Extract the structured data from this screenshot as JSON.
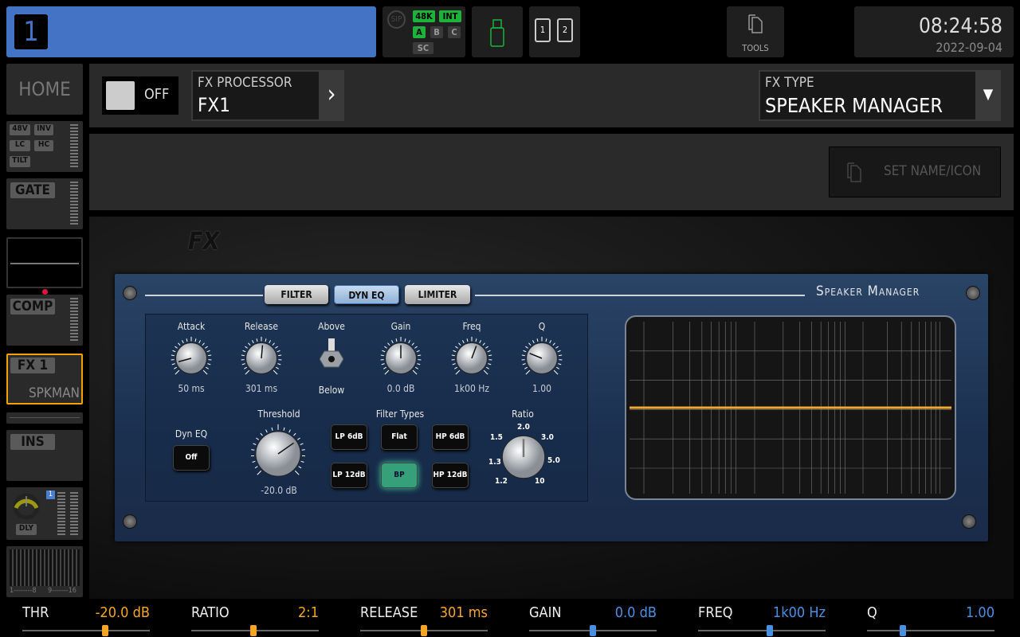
{
  "channel": {
    "number": "1",
    "color": "#4472c4"
  },
  "status": {
    "sip": "SIP",
    "rate": "48K",
    "clock": "INT",
    "a": "A",
    "b": "B",
    "c": "C",
    "sc": "SC"
  },
  "sd": {
    "slot1": "1",
    "slot2": "2"
  },
  "tools": {
    "label": "TOOLS"
  },
  "clock": {
    "time": "08:24:58",
    "date": "2022-09-04"
  },
  "sidebar": {
    "home": "HOME",
    "input": {
      "p48": "48V",
      "inv": "INV",
      "lc": "LC",
      "hc": "HC",
      "tilt": "TILT"
    },
    "gate": "GATE",
    "comp": "COMP",
    "fx": {
      "name": "FX 1",
      "type": "SPKMAN"
    },
    "ins": "INS",
    "dly": "DLY",
    "dly_bus": "1",
    "meters": {
      "range1": "1--------8",
      "range2": "9-------16"
    }
  },
  "header": {
    "toggle_label": "OFF",
    "processor_label": "FX PROCESSOR",
    "processor_value": "FX1",
    "type_label": "FX TYPE",
    "type_value": "SPEAKER MANAGER"
  },
  "set_name": {
    "label": "SET NAME/ICON"
  },
  "plugin": {
    "logo": "FX",
    "title": "Speaker Manager",
    "tabs": [
      {
        "label": "FILTER"
      },
      {
        "label": "DYN EQ",
        "active": true
      },
      {
        "label": "LIMITER"
      }
    ],
    "knobs": {
      "attack": {
        "label": "Attack",
        "value": "50 ms"
      },
      "release": {
        "label": "Release",
        "value": "301 ms"
      },
      "gain": {
        "label": "Gain",
        "value": "0.0 dB"
      },
      "freq": {
        "label": "Freq",
        "value": "1k00 Hz"
      },
      "q": {
        "label": "Q",
        "value": "1.00"
      },
      "threshold": {
        "label": "Threshold",
        "value": "-20.0 dB"
      },
      "ratio": {
        "label": "Ratio",
        "scale": [
          "1.2",
          "1.3",
          "1.5",
          "2.0",
          "3.0",
          "5.0",
          "10"
        ]
      }
    },
    "switch": {
      "above": "Above",
      "below": "Below"
    },
    "dyneq": {
      "label": "Dyn EQ",
      "value": "Off"
    },
    "filter_types": {
      "label": "Filter Types",
      "options": [
        "LP 6dB",
        "Flat",
        "HP 6dB",
        "LP 12dB",
        "BP",
        "HP 12dB"
      ],
      "selected": "BP"
    }
  },
  "bottom": [
    {
      "label": "THR",
      "value": "-20.0 dB",
      "color": "#f5a623",
      "level": 0.65
    },
    {
      "label": "RATIO",
      "value": "2:1",
      "color": "#f5a623",
      "level": 0.49
    },
    {
      "label": "RELEASE",
      "value": "301 ms",
      "color": "#f5a623",
      "level": 0.5
    },
    {
      "label": "GAIN",
      "value": "0.0 dB",
      "color": "#4a90e2",
      "level": 0.5
    },
    {
      "label": "FREQ",
      "value": "1k00 Hz",
      "color": "#4a90e2",
      "level": 0.56
    },
    {
      "label": "Q",
      "value": "1.00",
      "color": "#4a90e2",
      "level": 0.28
    }
  ]
}
